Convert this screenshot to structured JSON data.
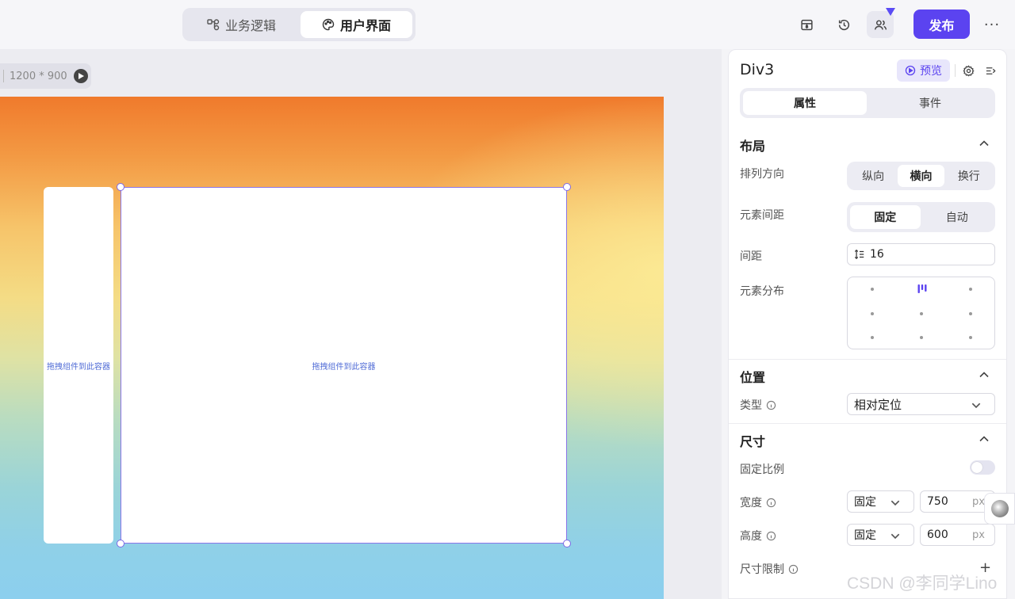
{
  "topbar": {
    "tabs": [
      {
        "label": "业务逻辑",
        "icon": "flow-icon",
        "active": false
      },
      {
        "label": "用户界面",
        "icon": "palette-icon",
        "active": true
      }
    ],
    "publish_label": "发布",
    "more_label": "···"
  },
  "canvas": {
    "size_label": "1200 * 900",
    "left_box_text": "拖拽组件到此容器",
    "main_box_text": "拖拽组件到此容器"
  },
  "panel": {
    "title": "Div3",
    "preview_label": "预览",
    "tabs": [
      {
        "label": "属性",
        "active": true
      },
      {
        "label": "事件",
        "active": false
      }
    ],
    "layout": {
      "title": "布局",
      "direction_label": "排列方向",
      "direction_options": [
        "纵向",
        "横向",
        "换行"
      ],
      "direction_selected": "横向",
      "spacing_mode_label": "元素间距",
      "spacing_mode_options": [
        "固定",
        "自动"
      ],
      "spacing_mode_selected": "固定",
      "gap_label": "间距",
      "gap_value": "16",
      "distribution_label": "元素分布"
    },
    "position": {
      "title": "位置",
      "type_label": "类型",
      "type_value": "相对定位"
    },
    "size": {
      "title": "尺寸",
      "lock_ratio_label": "固定比例",
      "lock_ratio_on": false,
      "width_label": "宽度",
      "width_mode": "固定",
      "width_value": "750",
      "height_label": "高度",
      "height_mode": "固定",
      "height_value": "600",
      "unit": "px",
      "limit_label": "尺寸限制",
      "plus_label": "+"
    }
  },
  "watermark": "CSDN @李同学Lino",
  "colors": {
    "accent": "#5b43f0",
    "selection": "#8a75e8",
    "drop_text": "#4f6bd6"
  }
}
